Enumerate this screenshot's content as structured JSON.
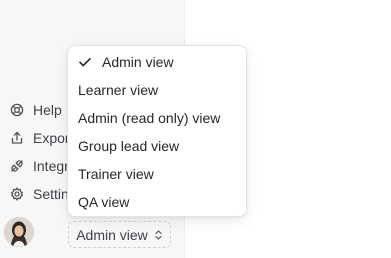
{
  "sidebar": {
    "items": [
      {
        "label": "Help",
        "icon": "help-circle-icon"
      },
      {
        "label": "Expor",
        "icon": "export-icon"
      },
      {
        "label": "Integr",
        "icon": "integrations-icon"
      },
      {
        "label": "Settin",
        "icon": "gear-icon"
      }
    ],
    "avatar_icon": "user-avatar",
    "view_switch": {
      "label": "Admin view",
      "icon": "chevron-up-down-icon"
    }
  },
  "menu": {
    "selected_icon": "checkmark-icon",
    "options": [
      {
        "label": "Admin view",
        "selected": true
      },
      {
        "label": "Learner view",
        "selected": false
      },
      {
        "label": "Admin (read only) view",
        "selected": false
      },
      {
        "label": "Group lead view",
        "selected": false
      },
      {
        "label": "Trainer view",
        "selected": false
      },
      {
        "label": "QA view",
        "selected": false
      }
    ]
  }
}
